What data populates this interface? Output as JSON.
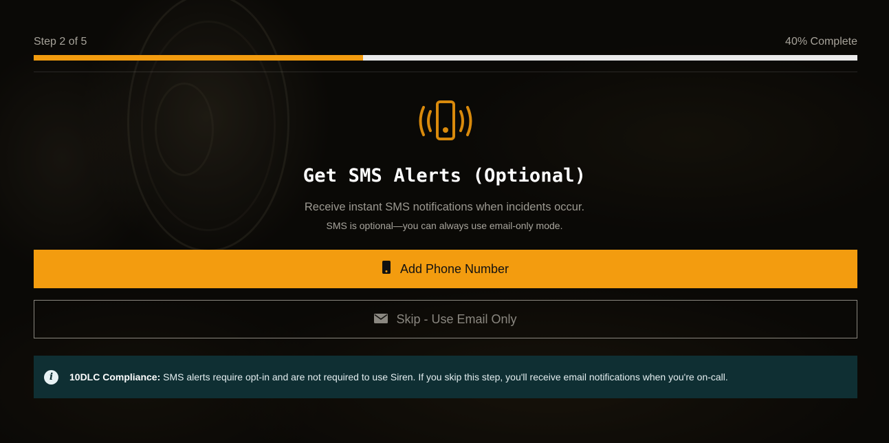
{
  "progress": {
    "step_label": "Step 2 of 5",
    "complete_label": "40% Complete",
    "fraction": 0.4,
    "fill_color": "#f39c0f",
    "track_color": "#ebebeb"
  },
  "hero": {
    "icon": "phone-vibrate-icon",
    "icon_color": "#d98a0c",
    "title": "Get SMS Alerts (Optional)",
    "subtitle": "Receive instant SMS notifications when incidents occur.",
    "note": "SMS is optional—you can always use email-only mode."
  },
  "actions": {
    "primary_label": "Add Phone Number",
    "primary_icon": "mobile-phone-icon",
    "primary_color": "#f39c0f",
    "secondary_label": "Skip - Use Email Only",
    "secondary_icon": "envelope-icon"
  },
  "info": {
    "icon": "info-icon",
    "strong": "10DLC Compliance:",
    "text": " SMS alerts require opt-in and are not required to use Siren. If you skip this step, you'll receive email notifications when you're on-call.",
    "bg_color": "#0f2f33"
  }
}
